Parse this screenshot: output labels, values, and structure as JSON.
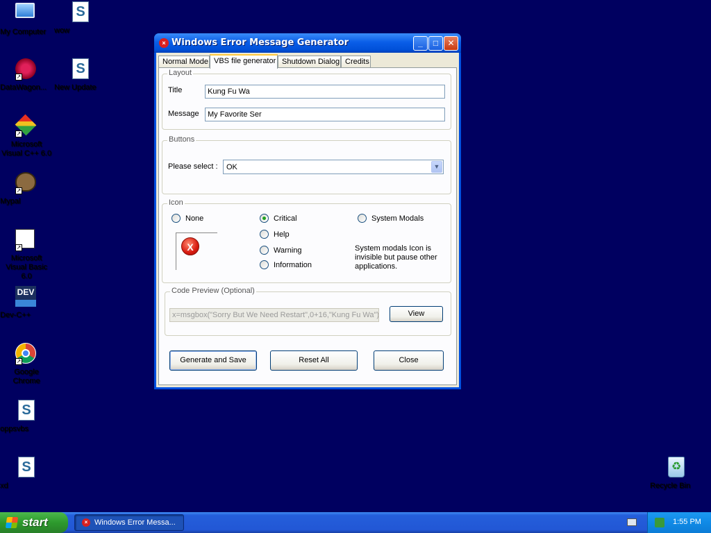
{
  "desktop": {
    "icons": [
      {
        "label": "My Computer",
        "icon": "computer-icon"
      },
      {
        "label": "wow",
        "icon": "vbs-script-icon"
      },
      {
        "label": "DataWagon...",
        "icon": "datawagon-icon"
      },
      {
        "label": "New Update",
        "icon": "vbs-script-icon"
      },
      {
        "label": "Microsoft Visual C++ 6.0",
        "icon": "visual-cpp-icon"
      },
      {
        "label": "Mypal",
        "icon": "mypal-icon"
      },
      {
        "label": "Microsoft Visual Basic 6.0",
        "icon": "visual-basic-icon"
      },
      {
        "label": "Dev-C++",
        "icon": "dev-cpp-icon"
      },
      {
        "label": "Google Chrome",
        "icon": "chrome-icon"
      },
      {
        "label": "oppsvbs",
        "icon": "vbs-script-icon"
      },
      {
        "label": "xd",
        "icon": "vbs-script-icon"
      },
      {
        "label": "Recycle Bin",
        "icon": "recycle-bin-icon"
      }
    ],
    "dev_badge": "DEV"
  },
  "window": {
    "title": "Windows Error Message Generator",
    "tabs": [
      "Normal Mode",
      "VBS file generator",
      "Shutdown Dialog",
      "Credits"
    ],
    "active_tab": "VBS file generator",
    "layout": {
      "legend": "Layout",
      "title_label": "Title",
      "title_value": "Kung Fu Wa",
      "message_label": "Message",
      "message_value": "My Favorite Ser"
    },
    "buttons_group": {
      "legend": "Buttons",
      "select_label": "Please select :",
      "selected": "OK"
    },
    "icon_group": {
      "legend": "Icon",
      "options": [
        "None",
        "Critical",
        "Help",
        "Warning",
        "Information",
        "System Modals"
      ],
      "selected": "Critical",
      "preview_glyph": "X",
      "note": "System modals Icon is invisible but pause other applications."
    },
    "code_preview": {
      "legend": "Code Preview (Optional)",
      "code": "x=msgbox(\"Sorry But We Need Restart\",0+16,\"Kung Fu Wa\")",
      "view_label": "View"
    },
    "actions": {
      "generate": "Generate and Save",
      "reset": "Reset All",
      "close": "Close"
    }
  },
  "taskbar": {
    "start_label": "start",
    "task_label": "Windows Error Messa...",
    "clock": "1:55 PM"
  },
  "colors": {
    "desktop_bg": "#000060",
    "titlebar": "#0050d8",
    "taskbar": "#245edb",
    "start": "#2d9a2d"
  }
}
